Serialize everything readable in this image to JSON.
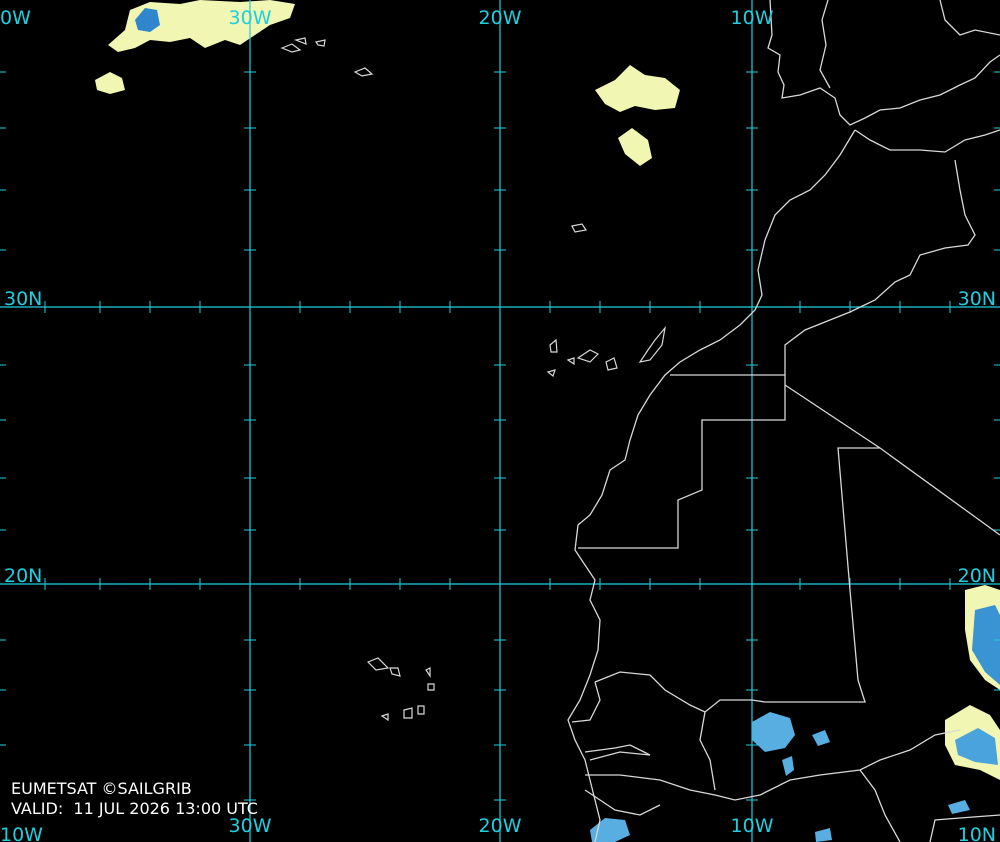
{
  "credit": "EUMETSAT ©SAILGRIB",
  "valid": "VALID:  11 JUL 2026 13:00 UTC",
  "labels": {
    "lon_top": [
      "0W",
      "30W",
      "20W",
      "10W"
    ],
    "lon_bottom": [
      "10W",
      "30W",
      "20W",
      "10W",
      "10N"
    ],
    "lat_left": [
      "30N",
      "20N"
    ],
    "lat_right": [
      "30N",
      "20N"
    ]
  },
  "colors": {
    "grid": "#1ecfe0",
    "coast": "#d8d8d8",
    "cloud_light": "#f4f7b0",
    "cloud_mid": "#79c6d8",
    "cloud_dark": "#2b82c9"
  }
}
